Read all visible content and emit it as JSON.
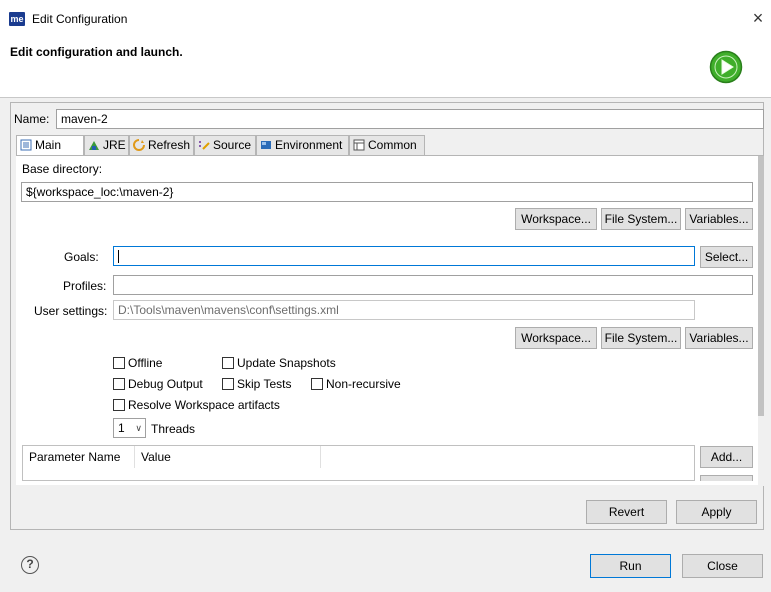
{
  "window": {
    "title": "Edit Configuration",
    "app_icon_text": "me"
  },
  "header": {
    "title": "Edit configuration and launch."
  },
  "name": {
    "label": "Name:",
    "value": "maven-2"
  },
  "tabs": [
    {
      "label": "Main",
      "icon": "main-tab-icon"
    },
    {
      "label": "JRE",
      "icon": "jre-icon"
    },
    {
      "label": "Refresh",
      "icon": "refresh-icon"
    },
    {
      "label": "Source",
      "icon": "source-icon"
    },
    {
      "label": "Environment",
      "icon": "environment-icon"
    },
    {
      "label": "Common",
      "icon": "common-icon"
    }
  ],
  "main": {
    "base_dir": {
      "label": "Base directory:",
      "value": "${workspace_loc:\\maven-2}"
    },
    "buttons1": {
      "workspace": "Workspace...",
      "filesystem": "File System...",
      "variables": "Variables..."
    },
    "goals": {
      "label": "Goals:",
      "value": "",
      "select": "Select..."
    },
    "profiles": {
      "label": "Profiles:",
      "value": ""
    },
    "user_settings": {
      "label": "User settings:",
      "value": "D:\\Tools\\maven\\mavens\\conf\\settings.xml"
    },
    "buttons2": {
      "workspace": "Workspace...",
      "filesystem": "File System...",
      "variables": "Variables..."
    },
    "checkboxes": {
      "offline": "Offline",
      "update_snapshots": "Update Snapshots",
      "debug_output": "Debug Output",
      "skip_tests": "Skip Tests",
      "non_recursive": "Non-recursive",
      "resolve_workspace": "Resolve Workspace artifacts"
    },
    "threads": {
      "value": "1",
      "label": "Threads"
    },
    "params": {
      "col_name": "Parameter Name",
      "col_value": "Value",
      "add": "Add..."
    }
  },
  "footer": {
    "revert": "Revert",
    "apply": "Apply",
    "run": "Run",
    "close": "Close"
  },
  "colors": {
    "accent": "#0078d7",
    "run_green": "#3fae2a"
  }
}
